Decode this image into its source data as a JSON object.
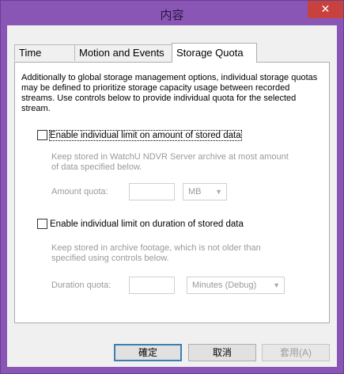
{
  "window": {
    "title": "内容",
    "close_glyph": "✕"
  },
  "tabs": [
    {
      "label": "Time Lapse",
      "active": false
    },
    {
      "label": "Motion and Events",
      "active": false
    },
    {
      "label": "Storage Quota",
      "active": true
    }
  ],
  "panel": {
    "description": "Additionally to global storage management options, individual storage quotas may be defined to prioritize storage capacity usage between recorded streams. Use controls below to provide individual quota for the selected stream.",
    "amount": {
      "checkbox_label": "Enable individual limit on amount of stored data",
      "checked": false,
      "hint": "Keep stored in WatchU NDVR Server archive at most amount of data specified below.",
      "field_label": "Amount quota:",
      "value": "",
      "unit": "MB"
    },
    "duration": {
      "checkbox_label": "Enable individual limit on duration of stored data",
      "checked": false,
      "hint": "Keep stored in archive footage, which is not older than specified using controls below.",
      "field_label": "Duration quota:",
      "value": "",
      "unit": "Minutes (Debug)"
    }
  },
  "buttons": {
    "ok": "確定",
    "cancel": "取消",
    "apply": "套用(A)"
  },
  "colors": {
    "frame": "#8a56b5",
    "close": "#c7423e",
    "default_border": "#3c7fb1"
  },
  "icons": {
    "dropdown": "chevron-down-icon",
    "close": "close-icon"
  }
}
